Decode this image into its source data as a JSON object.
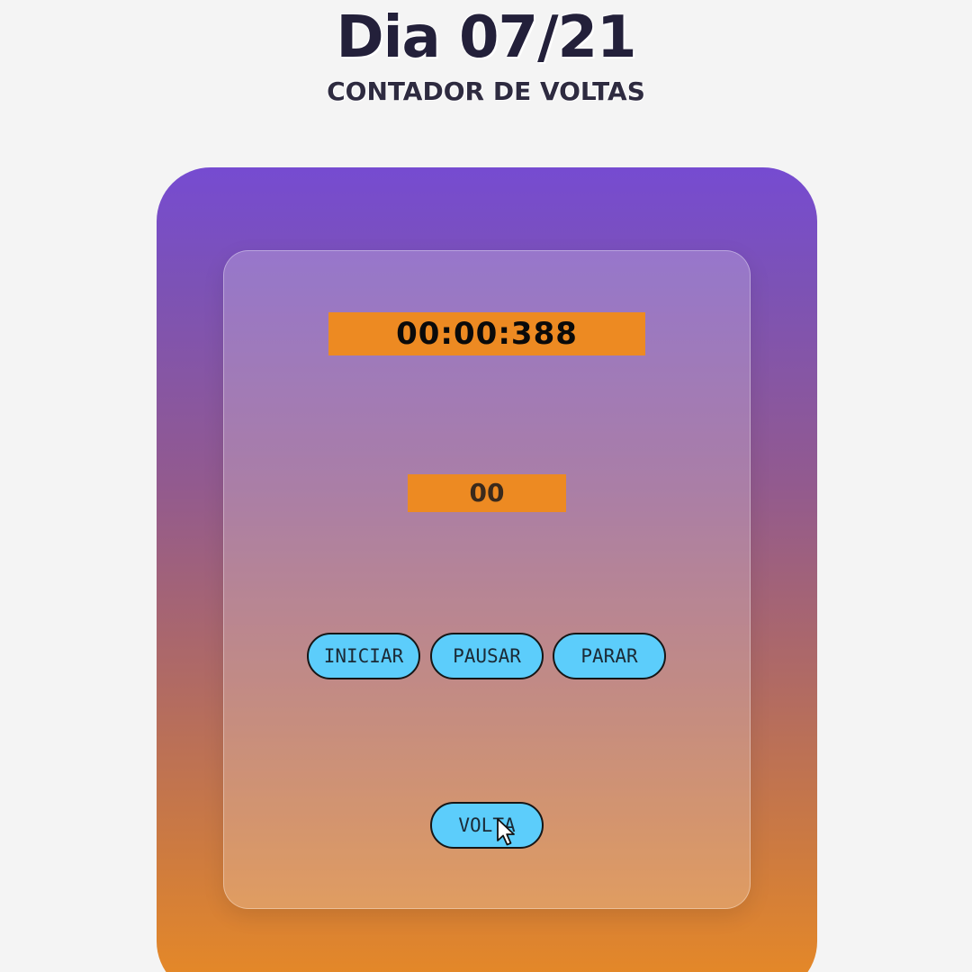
{
  "header": {
    "title": "Dia 07/21",
    "subtitle": "CONTADOR DE VOLTAS"
  },
  "timer": {
    "display": "00:00:388"
  },
  "laps": {
    "count": "00"
  },
  "controls": {
    "start_label": "INICIAR",
    "pause_label": "PAUSAR",
    "stop_label": "PARAR",
    "lap_label": "VOLTA"
  },
  "colors": {
    "background": "#f4f4f4",
    "gradient_top": "#764bd1",
    "gradient_bottom": "#e88a24",
    "display_bg": "#ed8a22",
    "button_bg": "#5ccdfb"
  },
  "icons": {
    "cursor": "mouse-pointer-icon"
  }
}
